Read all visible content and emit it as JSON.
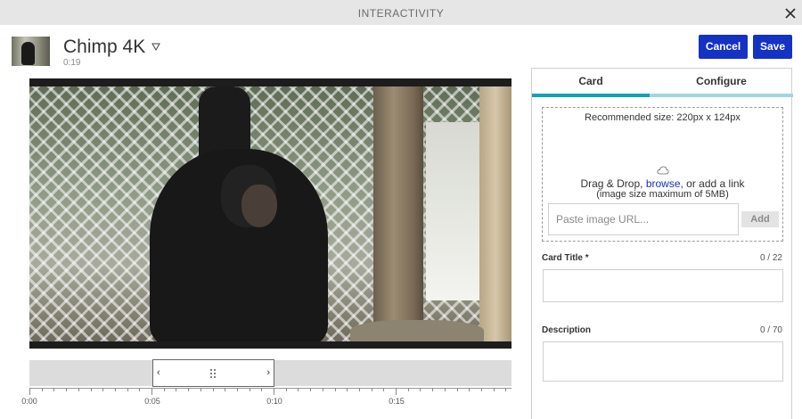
{
  "titlebar": {
    "title": "INTERACTIVITY"
  },
  "video": {
    "title": "Chimp 4K",
    "duration": "0:19"
  },
  "actions": {
    "cancel_label": "Cancel",
    "save_label": "Save"
  },
  "timeline": {
    "ticks": [
      "0:00",
      "0:05",
      "0:10",
      "0:15"
    ],
    "selection": {
      "start": "0:05",
      "end": "0:10"
    }
  },
  "panel": {
    "tabs": [
      {
        "label": "Card",
        "active": true
      },
      {
        "label": "Configure",
        "active": false
      }
    ],
    "image_upload": {
      "recommended": "Recommended size: 220px x 124px",
      "drag_text": "Drag & Drop, ",
      "browse_text": "browse",
      "link_text": ", or add a link",
      "limit_text": "(image size maximum of 5MB)",
      "url_placeholder": "Paste image URL...",
      "add_label": "Add"
    },
    "fields": [
      {
        "label": "Card Title *",
        "count": "0 / 22",
        "value": ""
      },
      {
        "label": "Description",
        "count": "0 / 70",
        "value": ""
      }
    ]
  },
  "colors": {
    "accent": "#1432c4",
    "tab_active": "#13a1b8",
    "tab_inactive": "#9fd7e0"
  },
  "icons": [
    "close-icon",
    "dropdown-caret-icon",
    "drag-grip-icon",
    "cloud-icon"
  ]
}
